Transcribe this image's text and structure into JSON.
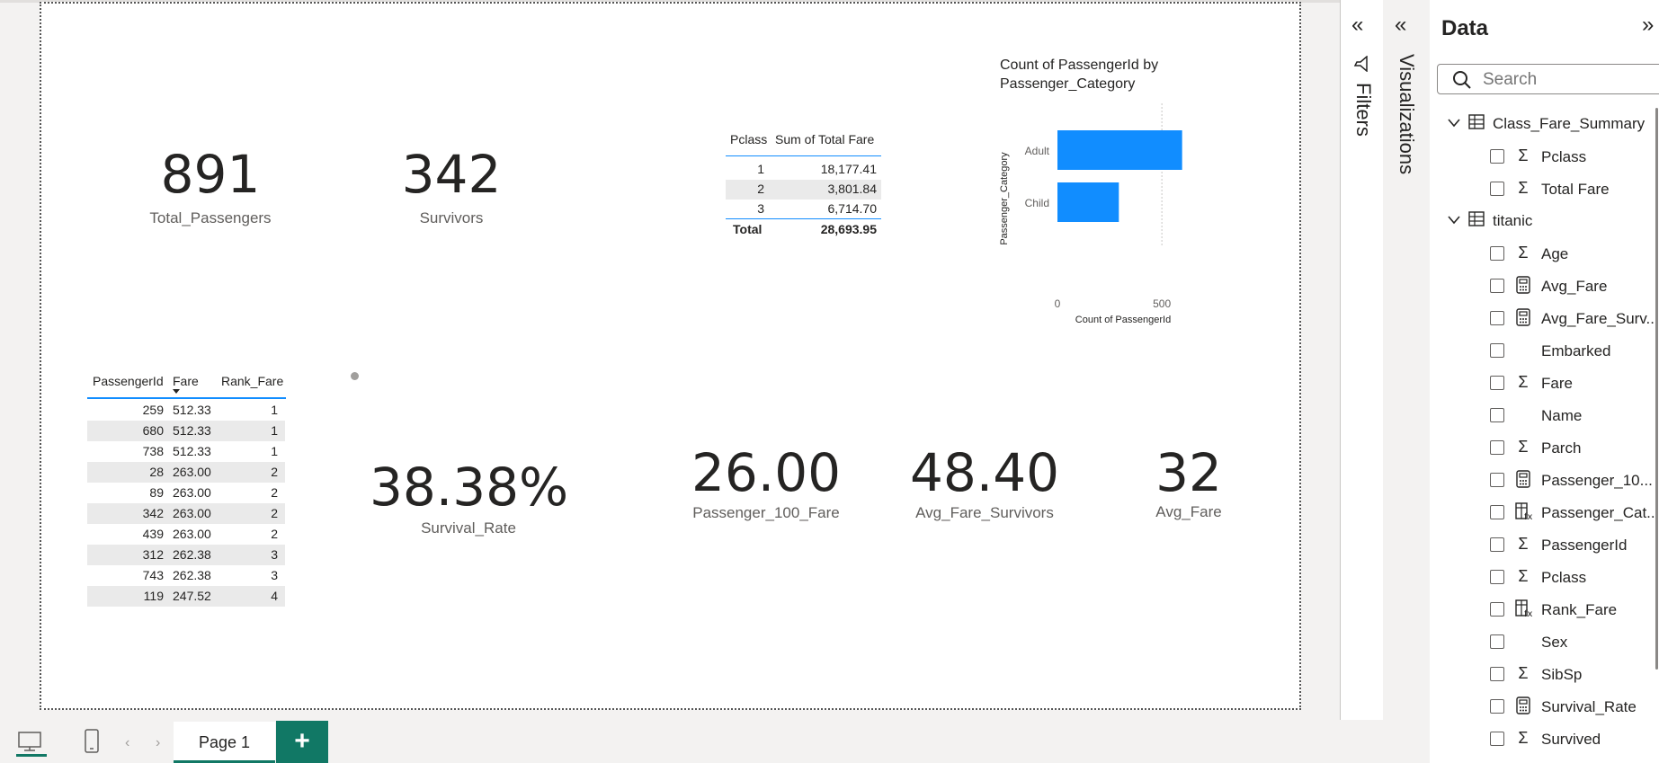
{
  "cards": {
    "total_passengers": {
      "value": "891",
      "label": "Total_Passengers"
    },
    "survivors": {
      "value": "342",
      "label": "Survivors"
    },
    "survival_rate": {
      "value": "38.38%",
      "label": "Survival_Rate"
    },
    "passenger_100_fare": {
      "value": "26.00",
      "label": "Passenger_100_Fare"
    },
    "avg_fare_survivors": {
      "value": "48.40",
      "label": "Avg_Fare_Survivors"
    },
    "avg_fare": {
      "value": "32",
      "label": "Avg_Fare"
    }
  },
  "class_table": {
    "headers": [
      "Pclass",
      "Sum of Total Fare"
    ],
    "rows": [
      [
        "1",
        "18,177.41"
      ],
      [
        "2",
        "3,801.84"
      ],
      [
        "3",
        "6,714.70"
      ]
    ],
    "total": [
      "Total",
      "28,693.95"
    ]
  },
  "rank_table": {
    "headers": [
      "PassengerId",
      "Fare",
      "Rank_Fare"
    ],
    "rows": [
      [
        "259",
        "512.33",
        "1"
      ],
      [
        "680",
        "512.33",
        "1"
      ],
      [
        "738",
        "512.33",
        "1"
      ],
      [
        "28",
        "263.00",
        "2"
      ],
      [
        "89",
        "263.00",
        "2"
      ],
      [
        "342",
        "263.00",
        "2"
      ],
      [
        "439",
        "263.00",
        "2"
      ],
      [
        "312",
        "262.38",
        "3"
      ],
      [
        "743",
        "262.38",
        "3"
      ],
      [
        "119",
        "247.52",
        "4"
      ]
    ]
  },
  "chart_data": {
    "type": "bar",
    "orientation": "horizontal",
    "title": "Count of PassengerId by Passenger_Category",
    "xlabel": "Count of PassengerId",
    "ylabel": "Passenger_Category",
    "categories": [
      "Adult",
      "Child"
    ],
    "values": [
      597,
      294
    ],
    "xlim": [
      0,
      620
    ],
    "xticks": [
      "0",
      "500"
    ],
    "bar_color": "#118DFF",
    "grid": true
  },
  "pages": {
    "tab_label": "Page 1",
    "add_label": "+"
  },
  "panes": {
    "filters_label": "Filters",
    "visualizations_label": "Visualizations",
    "data_title": "Data",
    "search_placeholder": "Search"
  },
  "data_fields": {
    "tables": [
      {
        "name": "Class_Fare_Summary",
        "fields": [
          {
            "name": "Pclass",
            "icon": "sigma"
          },
          {
            "name": "Total Fare",
            "icon": "sigma"
          }
        ]
      },
      {
        "name": "titanic",
        "fields": [
          {
            "name": "Age",
            "icon": "sigma"
          },
          {
            "name": "Avg_Fare",
            "icon": "calculator"
          },
          {
            "name": "Avg_Fare_Surv...",
            "icon": "calculator"
          },
          {
            "name": "Embarked",
            "icon": "none"
          },
          {
            "name": "Fare",
            "icon": "sigma"
          },
          {
            "name": "Name",
            "icon": "none"
          },
          {
            "name": "Parch",
            "icon": "sigma"
          },
          {
            "name": "Passenger_10...",
            "icon": "calculator"
          },
          {
            "name": "Passenger_Cat...",
            "icon": "calculated-column"
          },
          {
            "name": "PassengerId",
            "icon": "sigma"
          },
          {
            "name": "Pclass",
            "icon": "sigma"
          },
          {
            "name": "Rank_Fare",
            "icon": "calculated-column"
          },
          {
            "name": "Sex",
            "icon": "none"
          },
          {
            "name": "SibSp",
            "icon": "sigma"
          },
          {
            "name": "Survival_Rate",
            "icon": "calculator"
          },
          {
            "name": "Survived",
            "icon": "sigma"
          }
        ]
      }
    ]
  },
  "colors": {
    "accent": "#117865",
    "bar": "#118DFF",
    "table_line": "#118DFF"
  }
}
